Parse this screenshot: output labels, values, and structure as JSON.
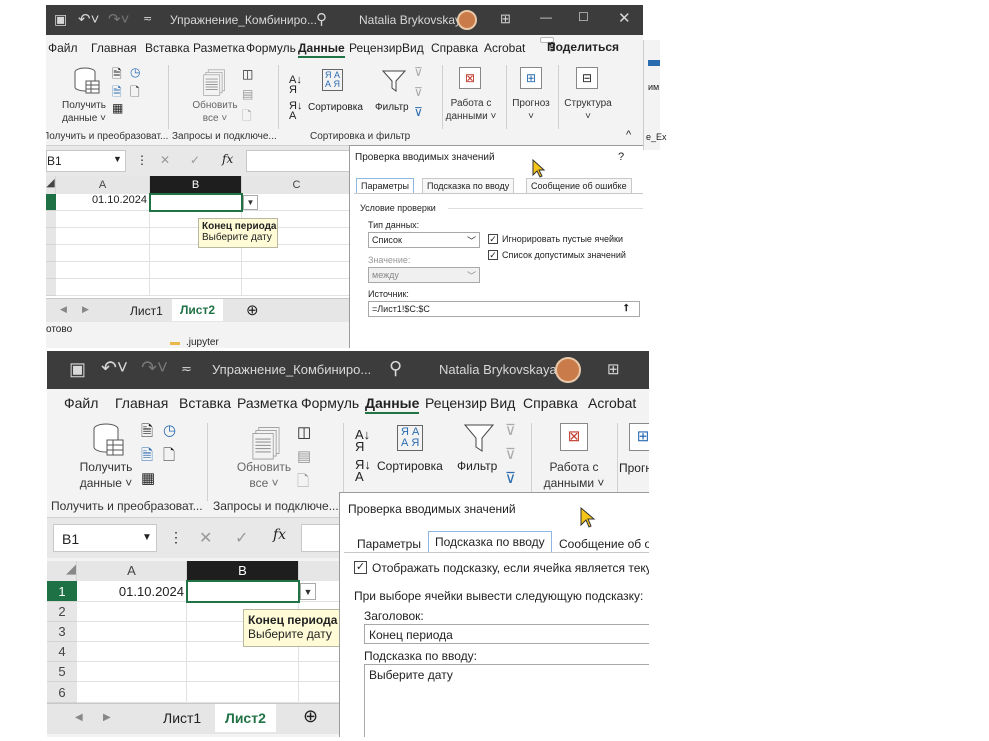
{
  "title_bar": {
    "qat_icons": [
      "save-icon",
      "undo-icon",
      "redo-icon",
      "customize-icon"
    ],
    "doc_title": "Упражнение_Комбиниро...",
    "search_icon": "search-icon",
    "user_name": "Natalia Brykovskaya",
    "win_controls": [
      "ribbon-display-icon",
      "minimize-icon",
      "maximize-icon",
      "close-icon"
    ]
  },
  "ribbon_tabs": {
    "file": "Файл",
    "home": "Главная",
    "insert": "Вставка",
    "layout": "Разметка",
    "formulas": "Формуль",
    "data": "Данные",
    "review": "Рецензир",
    "view": "Вид",
    "help": "Справка",
    "acrobat": "Acrobat",
    "share": "Поделиться"
  },
  "ribbon": {
    "get_data": "Получить",
    "get_data2": "данные ˅",
    "refresh": "Обновить",
    "refresh2": "все ˅",
    "sort": "Сортировка",
    "filter": "Фильтр",
    "data_tools": "Работа с",
    "data_tools2": "данными ˅",
    "forecast": "Прогноз",
    "forecast2": "˅",
    "outline": "Структура",
    "outline2": "˅",
    "group_get": "Получить и преобразоват...",
    "group_queries": "Запросы и подключе...",
    "group_sort": "Сортировка и фильтр",
    "sort_az": "А↓Я",
    "sort_icon_letters": "Я А\nА Я"
  },
  "formula_bar": {
    "name_box": "B1",
    "fx": "fx",
    "cancel": "✕",
    "enter": "✓"
  },
  "sheet": {
    "col_a": "A",
    "col_b": "B",
    "col_c": "C",
    "rows": [
      "1",
      "2",
      "3",
      "4",
      "5",
      "6"
    ],
    "a1_value": "01.10.2024",
    "tooltip_title": "Конец периода",
    "tooltip_text": "Выберите дату",
    "tabs": [
      "Лист1",
      "Лист2"
    ],
    "status": "отово",
    "folder": ".jupyter"
  },
  "dialog1": {
    "title": "Проверка вводимых значений",
    "help": "?",
    "tab_settings": "Параметры",
    "tab_input": "Подсказка по вводу",
    "tab_error": "Сообщение об ошибке",
    "section": "Условие проверки",
    "type_label": "Тип данных:",
    "type_value": "Список",
    "ignore_blank": "Игнорировать пустые ячейки",
    "incell_dropdown": "Список допустимых значений",
    "value_label": "Значение:",
    "value_value": "между",
    "source_label": "Источник:",
    "source_value": "=Лист1!$C:$C"
  },
  "dialog2": {
    "title": "Проверка вводимых значений",
    "tab_settings": "Параметры",
    "tab_input": "Подсказка по вводу",
    "tab_error": "Сообщение об о",
    "show_input": "Отображать подсказку, если ячейка является текущ",
    "instruction": "При выборе ячейки вывести следующую подсказку:",
    "title_label": "Заголовок:",
    "title_value": "Конец периода",
    "input_label": "Подсказка по вводу:",
    "input_value": "Выберите дату"
  },
  "right_strip": {
    "label1": "им",
    "label2": "е_Ex"
  },
  "colors": {
    "excel_green": "#217346",
    "title_bar": "#3c3c3c",
    "tooltip_bg": "#fffbd6"
  }
}
